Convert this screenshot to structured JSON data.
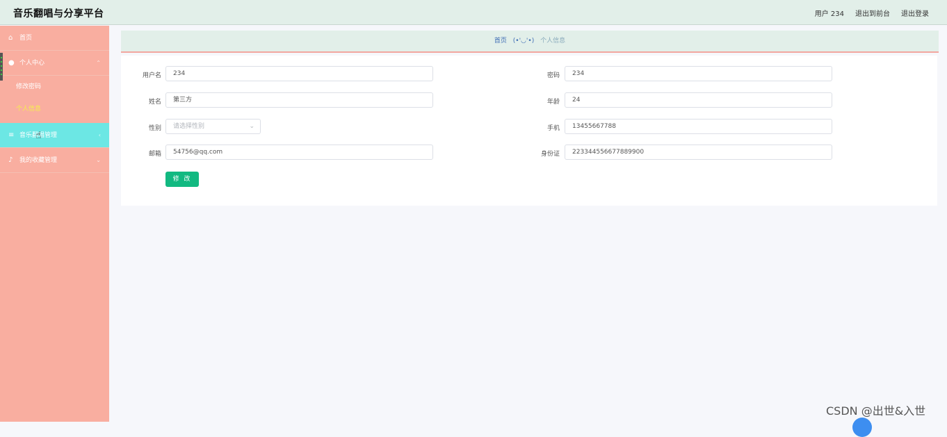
{
  "header": {
    "title": "音乐翻唱与分享平台",
    "user_label": "用户 234",
    "front_link": "退出到前台",
    "logout_link": "退出登录"
  },
  "sidebar": {
    "items": [
      {
        "label": "首页",
        "icon": "home-icon"
      },
      {
        "label": "个人中心",
        "icon": "user-icon",
        "children": [
          "修改密码",
          "个人信息"
        ]
      },
      {
        "label": "音乐翻唱管理",
        "icon": "list-icon"
      },
      {
        "label": "我的收藏管理",
        "icon": "mic-icon"
      }
    ],
    "active_child": "个人信息"
  },
  "breadcrumb": {
    "home": "首页",
    "separator": "(•'◡'•)",
    "current": "个人信息"
  },
  "form": {
    "username": {
      "label": "用户名",
      "value": "234"
    },
    "password": {
      "label": "密码",
      "value": "234"
    },
    "name": {
      "label": "姓名",
      "value": "第三方"
    },
    "age": {
      "label": "年龄",
      "value": "24"
    },
    "gender": {
      "label": "性别",
      "placeholder": "请选择性别"
    },
    "phone": {
      "label": "手机",
      "value": "13455667788"
    },
    "email": {
      "label": "邮箱",
      "value": "54756@qq.com"
    },
    "idcard": {
      "label": "身份证",
      "value": "223344556677889900"
    },
    "submit_label": "修 改"
  },
  "watermark": "CSDN @出世&入世",
  "colors": {
    "sidebar_bg": "#f9aea0",
    "sidebar_hover": "#6ce7e4",
    "active_text": "#f5f04a",
    "primary_button": "#12b981",
    "header_bg": "#e2efe9"
  }
}
